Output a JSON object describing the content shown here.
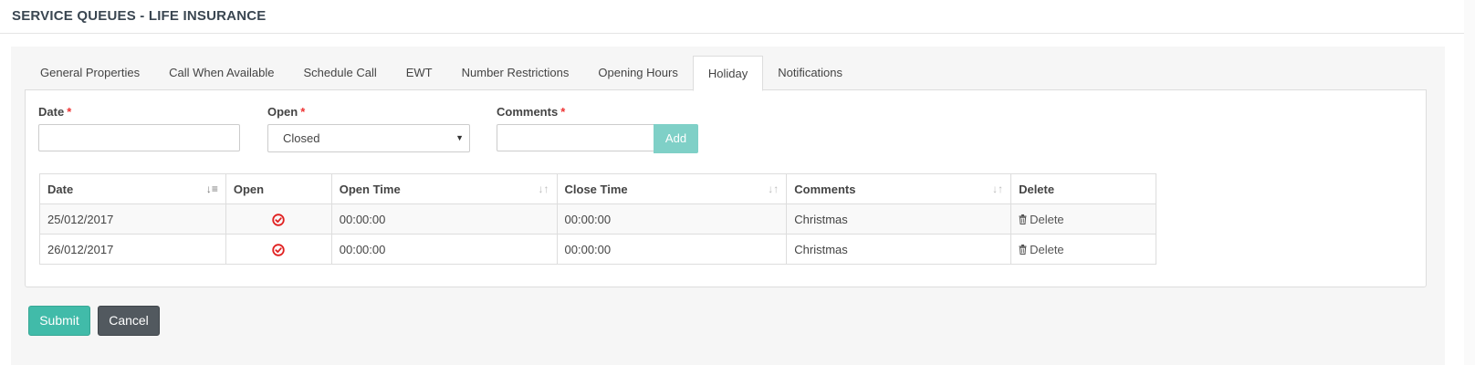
{
  "header": {
    "title": "SERVICE QUEUES - LIFE INSURANCE"
  },
  "tabs": [
    {
      "label": "General Properties"
    },
    {
      "label": "Call When Available"
    },
    {
      "label": "Schedule Call"
    },
    {
      "label": "EWT"
    },
    {
      "label": "Number Restrictions"
    },
    {
      "label": "Opening Hours"
    },
    {
      "label": "Holiday",
      "active": true
    },
    {
      "label": "Notifications"
    }
  ],
  "form": {
    "date_label": "Date",
    "open_label": "Open",
    "comments_label": "Comments",
    "required_mark": "*",
    "date_value": "",
    "open_value": "Closed",
    "comments_value": "",
    "add_label": "Add"
  },
  "table": {
    "headers": [
      "Date",
      "Open",
      "Open Time",
      "Close Time",
      "Comments",
      "Delete"
    ],
    "rows": [
      {
        "date": "25/012/2017",
        "open": "check-circle-icon",
        "open_time": "00:00:00",
        "close_time": "00:00:00",
        "comments": "Christmas",
        "delete": "Delete"
      },
      {
        "date": "26/012/2017",
        "open": "check-circle-icon",
        "open_time": "00:00:00",
        "close_time": "00:00:00",
        "comments": "Christmas",
        "delete": "Delete"
      }
    ]
  },
  "actions": {
    "submit_label": "Submit",
    "cancel_label": "Cancel"
  },
  "colors": {
    "accent": "#41bba9",
    "add_button": "#7fd0c7",
    "cancel_button": "#52595f",
    "required": "#e33333",
    "check_icon": "#e02020"
  }
}
